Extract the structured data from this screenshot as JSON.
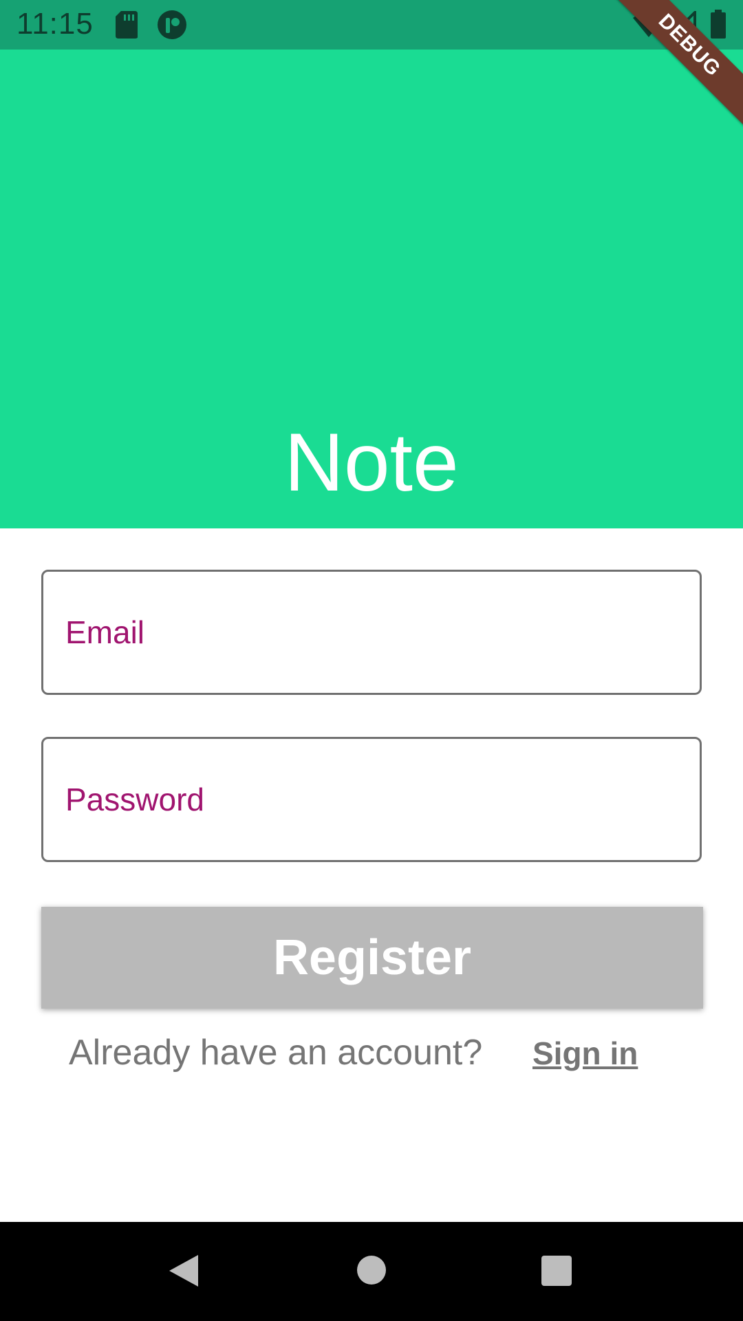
{
  "status_bar": {
    "time": "11:15",
    "icons": [
      "sd-card-icon",
      "app-notification-icon",
      "wifi-icon",
      "signal-icon",
      "battery-icon"
    ]
  },
  "debug_banner": {
    "label": "DEBUG"
  },
  "header": {
    "title": "Note",
    "background": "#1adc93"
  },
  "form": {
    "email": {
      "placeholder": "Email",
      "value": ""
    },
    "password": {
      "placeholder": "Password",
      "value": ""
    },
    "register_label": "Register"
  },
  "signin": {
    "prompt": "Already have an account?",
    "link_label": "Sign in"
  },
  "colors": {
    "accent": "#1adc93",
    "status_bar": "#16a273",
    "placeholder": "#a0146f",
    "button_disabled": "#b9b9b9"
  },
  "nav_bar": {
    "buttons": [
      "back-icon",
      "home-icon",
      "recents-icon"
    ]
  }
}
